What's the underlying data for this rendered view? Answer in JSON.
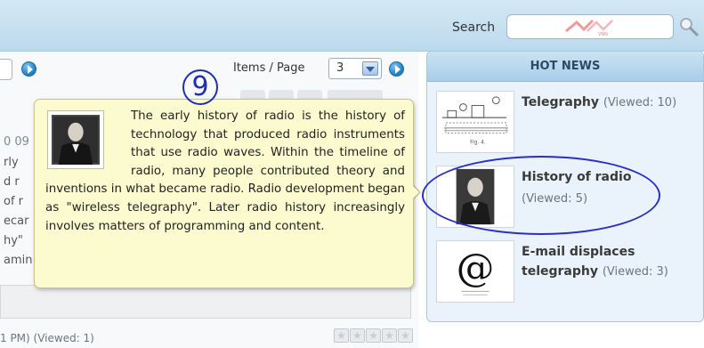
{
  "topbar": {
    "search_label": "Search",
    "search_value": ""
  },
  "left_panel": {
    "items_per_page_label": "Items / Page",
    "items_per_page_value": "3",
    "background_text_lines": [
      "0 09",
      "rly",
      "d r",
      "of r",
      "ecar",
      "hy\"",
      "amin"
    ],
    "article_meta": "1 PM) (Viewed: 1)"
  },
  "hot_news": {
    "title": "HOT NEWS",
    "items": [
      {
        "title": "Telegraphy",
        "viewed": "(Viewed: 10)"
      },
      {
        "title": "History of radio",
        "viewed": "(Viewed: 5)"
      },
      {
        "title": "E-mail displaces telegraphy",
        "viewed": "(Viewed: 3)"
      }
    ]
  },
  "tooltip": {
    "text": "The early history of radio is the history of technology that produced radio instruments that use radio waves. Within the timeline of radio, many people contributed theory and inventions in what became radio. Radio development began as \"wireless telegraphy\". Later radio history increasingly involves matters of programming and content."
  },
  "annotation": {
    "callout_number": "9"
  },
  "colors": {
    "topbar": "#c7e1f1",
    "tooltip_bg": "#fbfbcf",
    "hotnews_bg": "#eaf3fb",
    "annotation": "#2a2fc4"
  }
}
